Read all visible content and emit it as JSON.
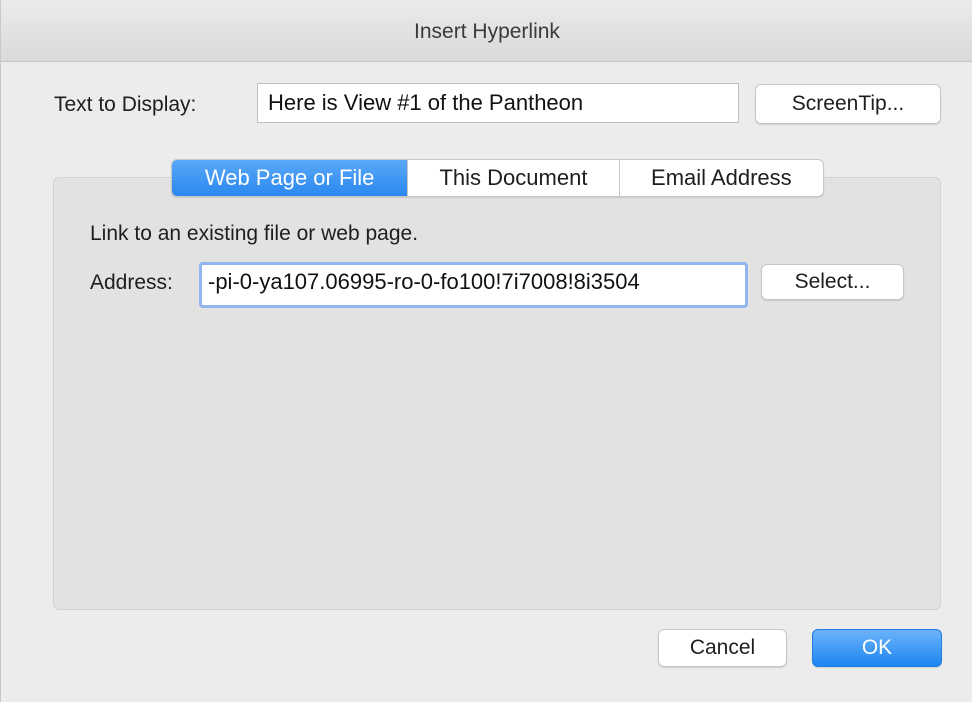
{
  "dialog": {
    "title": "Insert Hyperlink"
  },
  "display_text": {
    "label": "Text to Display:",
    "value": "Here is View #1 of the Pantheon",
    "screentip_button": "ScreenTip..."
  },
  "tabs": [
    {
      "label": "Web Page or File",
      "selected": true
    },
    {
      "label": "This Document",
      "selected": false
    },
    {
      "label": "Email Address",
      "selected": false
    }
  ],
  "web_page_tab": {
    "description": "Link to an existing file or web page.",
    "address_label": "Address:",
    "address_value": "-pi-0-ya107.06995-ro-0-fo100!7i7008!8i3504",
    "select_button": "Select..."
  },
  "footer": {
    "cancel_button": "Cancel",
    "ok_button": "OK"
  },
  "colors": {
    "accent": "#2a88f0",
    "focus_ring": "#8fb6ee"
  }
}
